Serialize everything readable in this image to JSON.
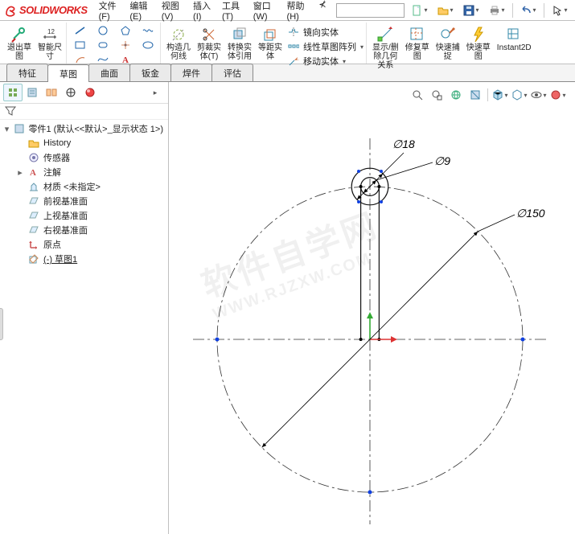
{
  "app_name": "SOLIDWORKS",
  "menus": [
    {
      "label": "文件(F)"
    },
    {
      "label": "编辑(E)"
    },
    {
      "label": "视图(V)"
    },
    {
      "label": "插入(I)"
    },
    {
      "label": "工具(T)"
    },
    {
      "label": "窗口(W)"
    },
    {
      "label": "帮助(H)"
    }
  ],
  "quick_access": [
    {
      "name": "new-doc-button",
      "icon": "doc"
    },
    {
      "name": "open-button",
      "icon": "folder"
    },
    {
      "name": "save-button",
      "icon": "save"
    },
    {
      "name": "print-button",
      "icon": "print"
    },
    {
      "name": "undo-button",
      "icon": "undo"
    },
    {
      "name": "select-button",
      "icon": "cursor"
    }
  ],
  "ribbon": {
    "left": [
      {
        "name": "exit-sketch-button",
        "label": "退出草\n图",
        "icon": "sketch-exit",
        "tint": "#2a7"
      },
      {
        "name": "smart-dimension-button",
        "label": "智能尺\n寸",
        "icon": "dim"
      }
    ],
    "tool_cols": [
      [
        {
          "i": "line"
        },
        {
          "i": "box"
        },
        {
          "i": "arc"
        }
      ],
      [
        {
          "i": "circle"
        },
        {
          "i": "slot"
        },
        {
          "i": "spline"
        }
      ],
      [
        {
          "i": "poly"
        },
        {
          "i": "point"
        },
        {
          "i": "text"
        }
      ],
      [
        {
          "i": "wave"
        },
        {
          "i": "ellipse"
        }
      ]
    ],
    "middle": [
      {
        "name": "construction-geometry-button",
        "label": "构造几\n何线",
        "icon": "constr"
      },
      {
        "name": "trim-entities-button",
        "label": "剪裁实\n体(T)",
        "icon": "trim"
      },
      {
        "name": "convert-entities-button",
        "label": "转换实\n体引用",
        "icon": "convert"
      },
      {
        "name": "offset-entities-button",
        "label": "等距实\n体",
        "icon": "offset"
      }
    ],
    "middle_rows": [
      {
        "name": "mirror-entities-button",
        "label": "镜向实体",
        "icon": "mirror"
      },
      {
        "name": "linear-pattern-button",
        "label": "线性草图阵列",
        "icon": "linear"
      },
      {
        "name": "move-entities-button",
        "label": "移动实体",
        "icon": "move"
      }
    ],
    "right": [
      {
        "name": "display-relations-button",
        "label": "显示/删\n除几何\n关系",
        "icon": "rel"
      },
      {
        "name": "repair-sketch-button",
        "label": "修复草\n图",
        "icon": "repair"
      },
      {
        "name": "quick-snap-button",
        "label": "快速捕\n捉",
        "icon": "snap"
      },
      {
        "name": "rapid-sketch-button",
        "label": "快速草\n图",
        "icon": "rapid"
      },
      {
        "name": "instant2d-button",
        "label": "Instant2D",
        "icon": "instant"
      }
    ]
  },
  "tabs": [
    {
      "label": "特征",
      "active": false
    },
    {
      "label": "草图",
      "active": true
    },
    {
      "label": "曲面",
      "active": false
    },
    {
      "label": "钣金",
      "active": false
    },
    {
      "label": "焊件",
      "active": false
    },
    {
      "label": "评估",
      "active": false
    }
  ],
  "side_tabs": [
    "feature-tree",
    "property",
    "config",
    "display",
    "appearance"
  ],
  "tree": {
    "root": "零件1  (默认<<默认>_显示状态 1>)",
    "children": [
      {
        "icon": "history",
        "label": "History",
        "kind": "folder"
      },
      {
        "icon": "sensor",
        "label": "传感器",
        "kind": "folder"
      },
      {
        "icon": "anno",
        "label": "注解",
        "kind": "folder-expand"
      },
      {
        "icon": "material",
        "label": "材质 <未指定>",
        "kind": "leaf"
      },
      {
        "icon": "plane",
        "label": "前视基准面",
        "kind": "leaf"
      },
      {
        "icon": "plane",
        "label": "上视基准面",
        "kind": "leaf"
      },
      {
        "icon": "plane",
        "label": "右视基准面",
        "kind": "leaf"
      },
      {
        "icon": "origin",
        "label": "原点",
        "kind": "leaf"
      },
      {
        "icon": "sketch",
        "label": "(-) 草图1",
        "kind": "leaf",
        "under": true
      }
    ]
  },
  "dimensions": {
    "d18": "∅18",
    "d9": "∅9",
    "d150": "∅150"
  },
  "watermark_top": "软件自学网",
  "watermark_bottom": "WWW.RJZXW.COM"
}
